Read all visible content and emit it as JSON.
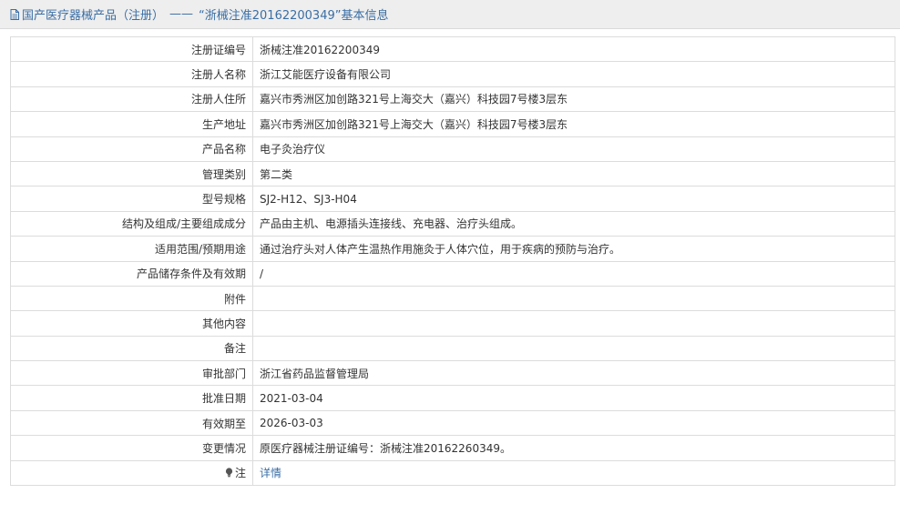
{
  "header": {
    "icon": "document-icon",
    "section": "国产医疗器械产品（注册）",
    "separator": "——",
    "record_title": "“浙械注准20162200349”基本信息"
  },
  "rows": [
    {
      "label": "注册证编号",
      "value": "浙械注准20162200349"
    },
    {
      "label": "注册人名称",
      "value": "浙江艾能医疗设备有限公司"
    },
    {
      "label": "注册人住所",
      "value": "嘉兴市秀洲区加创路321号上海交大（嘉兴）科技园7号楼3层东"
    },
    {
      "label": "生产地址",
      "value": "嘉兴市秀洲区加创路321号上海交大（嘉兴）科技园7号楼3层东"
    },
    {
      "label": "产品名称",
      "value": "电子灸治疗仪"
    },
    {
      "label": "管理类别",
      "value": "第二类"
    },
    {
      "label": "型号规格",
      "value": "SJ2-H12、SJ3-H04"
    },
    {
      "label": "结构及组成/主要组成成分",
      "value": "产品由主机、电源插头连接线、充电器、治疗头组成。"
    },
    {
      "label": "适用范围/预期用途",
      "value": "通过治疗头对人体产生温热作用施灸于人体穴位，用于疾病的预防与治疗。"
    },
    {
      "label": "产品储存条件及有效期",
      "value": "/"
    },
    {
      "label": "附件",
      "value": ""
    },
    {
      "label": "其他内容",
      "value": ""
    },
    {
      "label": "备注",
      "value": ""
    },
    {
      "label": "审批部门",
      "value": "浙江省药品监督管理局"
    },
    {
      "label": "批准日期",
      "value": "2021-03-04"
    },
    {
      "label": "有效期至",
      "value": "2026-03-03"
    },
    {
      "label": "变更情况",
      "value": "原医疗器械注册证编号：浙械注准20162260349。"
    }
  ],
  "note_row": {
    "icon": "bulb-icon",
    "label": "注",
    "link_text": "详情"
  },
  "colors": {
    "link": "#3a6ea5",
    "border": "#dcdcdc",
    "titlebar_bg": "#eeeeee"
  }
}
